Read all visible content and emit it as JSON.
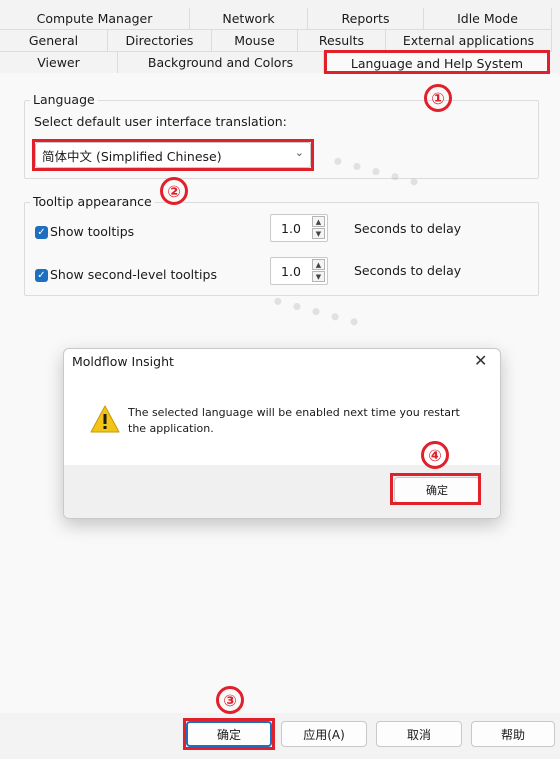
{
  "tabs": {
    "row1": [
      "Compute Manager",
      "Network",
      "Reports",
      "Idle Mode"
    ],
    "row2": [
      "General",
      "Directories",
      "Mouse",
      "Results",
      "External applications"
    ],
    "row3": [
      "Viewer",
      "Background and Colors",
      "Language and Help System"
    ]
  },
  "language_group": {
    "legend": "Language",
    "prompt": "Select default user interface translation:",
    "selected": "简体中文 (Simplified Chinese)"
  },
  "tooltip_group": {
    "legend": "Tooltip appearance",
    "rows": [
      {
        "label": "Show tooltips",
        "checked": true,
        "value": "1.0",
        "unit": "Seconds to delay"
      },
      {
        "label": "Show second-level tooltips",
        "checked": true,
        "value": "1.0",
        "unit": "Seconds to delay"
      }
    ]
  },
  "dialog": {
    "title": "Moldflow Insight",
    "message": "The selected language will be enabled next time you restart the application.",
    "ok_label": "确定"
  },
  "bottom_buttons": {
    "ok": "确定",
    "apply": "应用(A)",
    "cancel": "取消",
    "help": "帮助"
  },
  "annotations": {
    "badge1": "①",
    "badge2": "②",
    "badge3": "③",
    "badge4": "④"
  },
  "colors": {
    "highlight": "#e0202a",
    "checkbox": "#1e6fbf",
    "warning": "#f2c417"
  }
}
